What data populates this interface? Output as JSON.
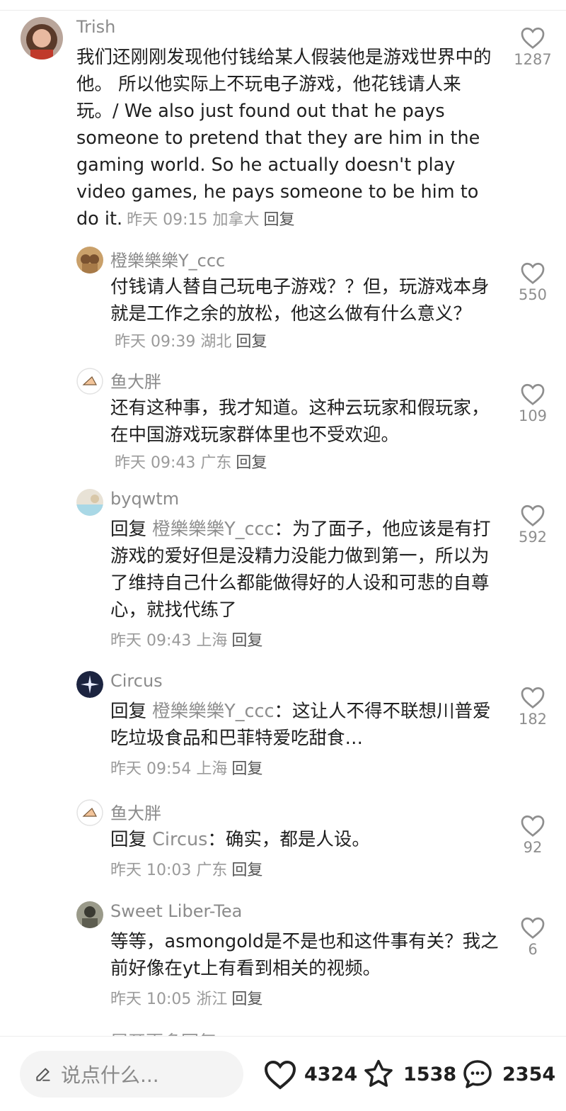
{
  "comments": [
    {
      "username": "Trish",
      "text": "我们还刚刚发现他付钱给某人假装他是游戏世界中的他。 所以他实际上不玩电子游戏，他花钱请人来玩。/ We also just found out that he pays someone to pretend that they are him in the gaming world.  So he actually doesn't play video games, he pays someone to be him to do it.",
      "time": "昨天 09:15",
      "location": "加拿大",
      "reply_label": "回复",
      "likes": "1287"
    }
  ],
  "replies": [
    {
      "username": "橙樂樂樂Y_ccc",
      "text": "付钱请人替自己玩电子游戏？？但，玩游戏本身就是工作之余的放松，他这么做有什么意义？",
      "time": "昨天 09:39",
      "location": "湖北",
      "reply_label": "回复",
      "likes": "550"
    },
    {
      "username": "鱼大胖",
      "text": "还有这种事，我才知道。这种云玩家和假玩家，在中国游戏玩家群体里也不受欢迎。",
      "time": "昨天 09:43",
      "location": "广东",
      "reply_label": "回复",
      "likes": "109"
    },
    {
      "username": "byqwtm",
      "prefix": "回复",
      "target": "橙樂樂樂Y_ccc",
      "text": "：为了面子，他应该是有打游戏的爱好但是没精力没能力做到第一，所以为了维持自己什么都能做得好的人设和可悲的自尊心，就找代练了",
      "time": "昨天 09:43",
      "location": "上海",
      "reply_label": "回复",
      "likes": "592"
    },
    {
      "username": "Circus",
      "prefix": "回复",
      "target": "橙樂樂樂Y_ccc",
      "text": "：这让人不得不联想川普爱吃垃圾食品和巴菲特爱吃甜食…",
      "time": "昨天 09:54",
      "location": "上海",
      "reply_label": "回复",
      "likes": "182"
    },
    {
      "username": "鱼大胖",
      "prefix": "回复",
      "target": "Circus",
      "text": "：确实，都是人设。",
      "time": "昨天 10:03",
      "location": "广东",
      "reply_label": "回复",
      "likes": "92"
    },
    {
      "username": "Sweet Liber-Tea",
      "text": "等等，asmongold是不是也和这件事有关？我之前好像在yt上有看到相关的视频。",
      "time": "昨天 10:05",
      "location": "浙江",
      "reply_label": "回复",
      "likes": "6"
    }
  ],
  "more_replies_hint": "展开更多回复",
  "bottom_bar": {
    "input_placeholder": "说点什么...",
    "like_count": "4324",
    "favorite_count": "1538",
    "comment_count": "2354"
  },
  "colors": {
    "text": "#1f1f1f",
    "muted": "#8b8b8b",
    "icon": "#222222",
    "background": "#ffffff"
  }
}
